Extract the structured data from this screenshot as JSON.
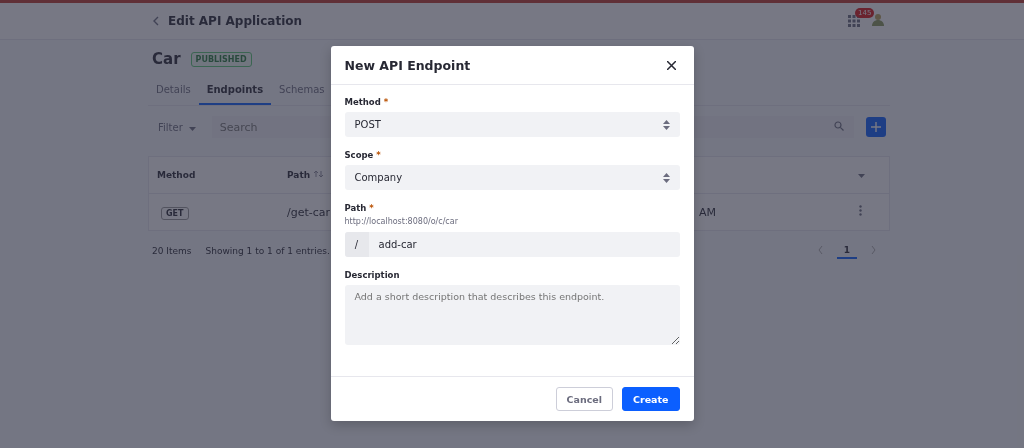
{
  "header": {
    "title": "Edit API Application",
    "notification_count": "145"
  },
  "application": {
    "name": "Car",
    "status": "PUBLISHED"
  },
  "tabs": [
    {
      "label": "Details",
      "selected": false
    },
    {
      "label": "Endpoints",
      "selected": true
    },
    {
      "label": "Schemas",
      "selected": false
    }
  ],
  "toolbar": {
    "filter": "Filter",
    "search_placeholder": "Search"
  },
  "table": {
    "columns": [
      "Method",
      "Path"
    ],
    "rows": [
      {
        "method": "GET",
        "path": "/get-car",
        "column_3": "AM"
      }
    ]
  },
  "pagination": {
    "page_size": "20 Items",
    "summary": "Showing 1 to 1 of 1 entries.",
    "pages": [
      {
        "label": "1",
        "selected": true
      }
    ]
  },
  "dialog": {
    "title": "New API Endpoint",
    "fields": [
      {
        "kind": "select",
        "label": "Method",
        "required_mark": "*",
        "value": "POST"
      },
      {
        "kind": "select",
        "label": "Scope",
        "required_mark": "*",
        "value": "Company"
      },
      {
        "kind": "path",
        "label": "Path",
        "required_mark": "*",
        "hint": "http://localhost:8080/o/c/car",
        "prefix": "/",
        "value": "add-car"
      },
      {
        "kind": "textarea",
        "label": "Description",
        "placeholder": "Add a short description that describes this endpoint."
      }
    ],
    "buttons": [
      {
        "label": "Cancel",
        "kind": "secondary"
      },
      {
        "label": "Create",
        "kind": "primary"
      }
    ]
  }
}
